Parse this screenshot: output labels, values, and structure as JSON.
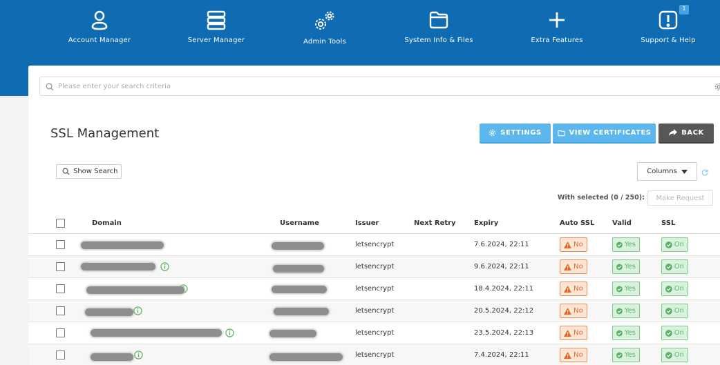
{
  "nav": [
    {
      "label": "Account Manager",
      "icon": "user-icon"
    },
    {
      "label": "Server Manager",
      "icon": "server-icon"
    },
    {
      "label": "Admin Tools",
      "icon": "gears-icon"
    },
    {
      "label": "System Info & Files",
      "icon": "folder-icon"
    },
    {
      "label": "Extra Features",
      "icon": "plus-icon"
    },
    {
      "label": "Support & Help",
      "icon": "alert-icon",
      "badge": "1"
    }
  ],
  "search": {
    "placeholder": "Please enter your search criteria"
  },
  "page": {
    "title": "SSL Management"
  },
  "toolbar": {
    "settings_label": "SETTINGS",
    "view_certificates_label": "VIEW CERTIFICATES",
    "back_label": "BACK"
  },
  "controls": {
    "show_search_label": "Show Search",
    "columns_label": "Columns",
    "with_selected_label": "With selected (0 / 250):",
    "make_request_label": "Make Request"
  },
  "table": {
    "headers": {
      "domain": "Domain",
      "username": "Username",
      "issuer": "Issuer",
      "next_retry": "Next Retry",
      "expiry": "Expiry",
      "auto_ssl": "Auto SSL",
      "valid": "Valid",
      "ssl": "SSL"
    },
    "rows": [
      {
        "issuer": "letsencrypt",
        "next_retry": "",
        "expiry": "7.6.2024, 22:11",
        "auto_ssl": "No",
        "valid": "Yes",
        "ssl": "On"
      },
      {
        "issuer": "letsencrypt",
        "next_retry": "",
        "expiry": "9.6.2024, 22:11",
        "auto_ssl": "No",
        "valid": "Yes",
        "ssl": "On"
      },
      {
        "issuer": "letsencrypt",
        "next_retry": "",
        "expiry": "18.4.2024, 22:11",
        "auto_ssl": "No",
        "valid": "Yes",
        "ssl": "On"
      },
      {
        "issuer": "letsencrypt",
        "next_retry": "",
        "expiry": "20.5.2024, 22:12",
        "auto_ssl": "No",
        "valid": "Yes",
        "ssl": "On"
      },
      {
        "issuer": "letsencrypt",
        "next_retry": "",
        "expiry": "23.5.2024, 22:13",
        "auto_ssl": "No",
        "valid": "Yes",
        "ssl": "On"
      },
      {
        "issuer": "letsencrypt",
        "next_retry": "",
        "expiry": "7.4.2024, 22:11",
        "auto_ssl": "No",
        "valid": "Yes",
        "ssl": "On"
      }
    ]
  },
  "colors": {
    "topbar": "#0f6cb3",
    "primary_button": "#5bb7ee",
    "back_button": "#585858",
    "warning": "#e06a25",
    "success": "#5bb06a"
  }
}
